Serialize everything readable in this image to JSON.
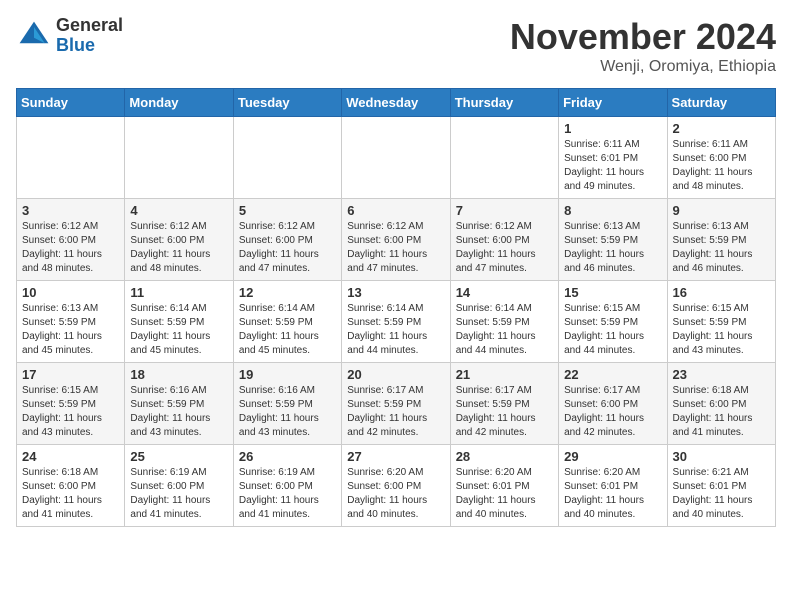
{
  "header": {
    "logo_general": "General",
    "logo_blue": "Blue",
    "month_title": "November 2024",
    "location": "Wenji, Oromiya, Ethiopia"
  },
  "days_of_week": [
    "Sunday",
    "Monday",
    "Tuesday",
    "Wednesday",
    "Thursday",
    "Friday",
    "Saturday"
  ],
  "weeks": [
    [
      {
        "day": "",
        "info": ""
      },
      {
        "day": "",
        "info": ""
      },
      {
        "day": "",
        "info": ""
      },
      {
        "day": "",
        "info": ""
      },
      {
        "day": "",
        "info": ""
      },
      {
        "day": "1",
        "info": "Sunrise: 6:11 AM\nSunset: 6:01 PM\nDaylight: 11 hours and 49 minutes."
      },
      {
        "day": "2",
        "info": "Sunrise: 6:11 AM\nSunset: 6:00 PM\nDaylight: 11 hours and 48 minutes."
      }
    ],
    [
      {
        "day": "3",
        "info": "Sunrise: 6:12 AM\nSunset: 6:00 PM\nDaylight: 11 hours and 48 minutes."
      },
      {
        "day": "4",
        "info": "Sunrise: 6:12 AM\nSunset: 6:00 PM\nDaylight: 11 hours and 48 minutes."
      },
      {
        "day": "5",
        "info": "Sunrise: 6:12 AM\nSunset: 6:00 PM\nDaylight: 11 hours and 47 minutes."
      },
      {
        "day": "6",
        "info": "Sunrise: 6:12 AM\nSunset: 6:00 PM\nDaylight: 11 hours and 47 minutes."
      },
      {
        "day": "7",
        "info": "Sunrise: 6:12 AM\nSunset: 6:00 PM\nDaylight: 11 hours and 47 minutes."
      },
      {
        "day": "8",
        "info": "Sunrise: 6:13 AM\nSunset: 5:59 PM\nDaylight: 11 hours and 46 minutes."
      },
      {
        "day": "9",
        "info": "Sunrise: 6:13 AM\nSunset: 5:59 PM\nDaylight: 11 hours and 46 minutes."
      }
    ],
    [
      {
        "day": "10",
        "info": "Sunrise: 6:13 AM\nSunset: 5:59 PM\nDaylight: 11 hours and 45 minutes."
      },
      {
        "day": "11",
        "info": "Sunrise: 6:14 AM\nSunset: 5:59 PM\nDaylight: 11 hours and 45 minutes."
      },
      {
        "day": "12",
        "info": "Sunrise: 6:14 AM\nSunset: 5:59 PM\nDaylight: 11 hours and 45 minutes."
      },
      {
        "day": "13",
        "info": "Sunrise: 6:14 AM\nSunset: 5:59 PM\nDaylight: 11 hours and 44 minutes."
      },
      {
        "day": "14",
        "info": "Sunrise: 6:14 AM\nSunset: 5:59 PM\nDaylight: 11 hours and 44 minutes."
      },
      {
        "day": "15",
        "info": "Sunrise: 6:15 AM\nSunset: 5:59 PM\nDaylight: 11 hours and 44 minutes."
      },
      {
        "day": "16",
        "info": "Sunrise: 6:15 AM\nSunset: 5:59 PM\nDaylight: 11 hours and 43 minutes."
      }
    ],
    [
      {
        "day": "17",
        "info": "Sunrise: 6:15 AM\nSunset: 5:59 PM\nDaylight: 11 hours and 43 minutes."
      },
      {
        "day": "18",
        "info": "Sunrise: 6:16 AM\nSunset: 5:59 PM\nDaylight: 11 hours and 43 minutes."
      },
      {
        "day": "19",
        "info": "Sunrise: 6:16 AM\nSunset: 5:59 PM\nDaylight: 11 hours and 43 minutes."
      },
      {
        "day": "20",
        "info": "Sunrise: 6:17 AM\nSunset: 5:59 PM\nDaylight: 11 hours and 42 minutes."
      },
      {
        "day": "21",
        "info": "Sunrise: 6:17 AM\nSunset: 5:59 PM\nDaylight: 11 hours and 42 minutes."
      },
      {
        "day": "22",
        "info": "Sunrise: 6:17 AM\nSunset: 6:00 PM\nDaylight: 11 hours and 42 minutes."
      },
      {
        "day": "23",
        "info": "Sunrise: 6:18 AM\nSunset: 6:00 PM\nDaylight: 11 hours and 41 minutes."
      }
    ],
    [
      {
        "day": "24",
        "info": "Sunrise: 6:18 AM\nSunset: 6:00 PM\nDaylight: 11 hours and 41 minutes."
      },
      {
        "day": "25",
        "info": "Sunrise: 6:19 AM\nSunset: 6:00 PM\nDaylight: 11 hours and 41 minutes."
      },
      {
        "day": "26",
        "info": "Sunrise: 6:19 AM\nSunset: 6:00 PM\nDaylight: 11 hours and 41 minutes."
      },
      {
        "day": "27",
        "info": "Sunrise: 6:20 AM\nSunset: 6:00 PM\nDaylight: 11 hours and 40 minutes."
      },
      {
        "day": "28",
        "info": "Sunrise: 6:20 AM\nSunset: 6:01 PM\nDaylight: 11 hours and 40 minutes."
      },
      {
        "day": "29",
        "info": "Sunrise: 6:20 AM\nSunset: 6:01 PM\nDaylight: 11 hours and 40 minutes."
      },
      {
        "day": "30",
        "info": "Sunrise: 6:21 AM\nSunset: 6:01 PM\nDaylight: 11 hours and 40 minutes."
      }
    ]
  ]
}
